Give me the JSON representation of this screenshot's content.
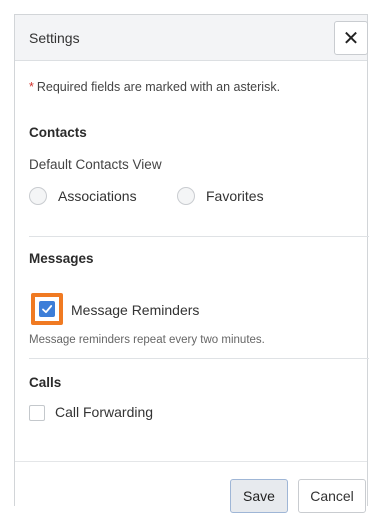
{
  "dialog": {
    "title": "Settings",
    "close_label": "✕",
    "required_note": "Required fields are marked with an asterisk.",
    "required_marker": "*"
  },
  "contacts": {
    "section_title": "Contacts",
    "field_label": "Default Contacts View",
    "options": [
      {
        "label": "Associations",
        "selected": false
      },
      {
        "label": "Favorites",
        "selected": false
      }
    ]
  },
  "messages": {
    "section_title": "Messages",
    "reminders_label": "Message Reminders",
    "reminders_checked": true,
    "helper_text": "Message reminders repeat every two minutes."
  },
  "calls": {
    "section_title": "Calls",
    "forwarding_label": "Call Forwarding",
    "forwarding_checked": false
  },
  "footer": {
    "save_label": "Save",
    "cancel_label": "Cancel"
  },
  "colors": {
    "accent": "#3d7ed8",
    "highlight": "#f07a22",
    "required": "#d0302b"
  }
}
